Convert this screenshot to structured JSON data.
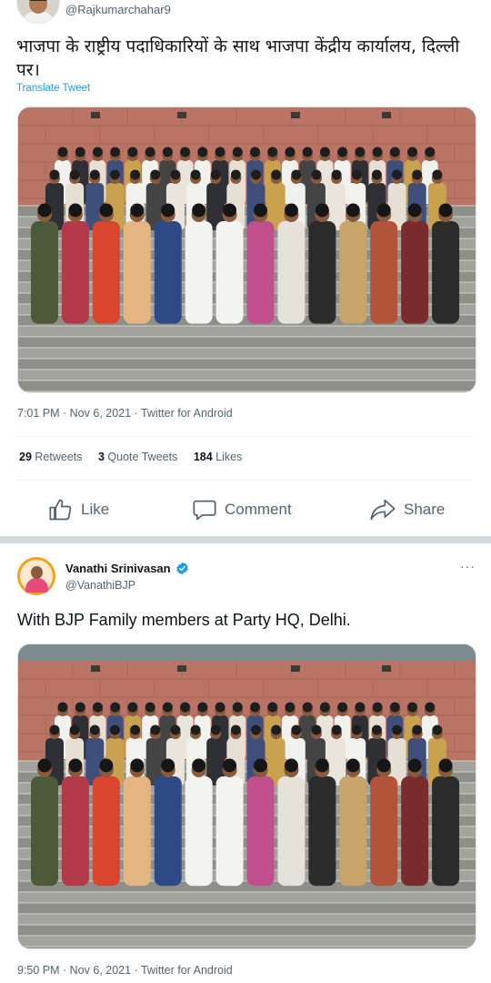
{
  "tweet1": {
    "handle": "@Rajkumarchahar9",
    "text": "भाजपा के राष्ट्रीय पदाधिकारियों के साथ भाजपा केंद्रीय कार्यालय, दिल्ली पर।",
    "translate": "Translate Tweet",
    "timestamp": "7:01 PM · Nov 6, 2021 · Twitter for Android",
    "stats": {
      "retweets_count": "29",
      "retweets_label": "Retweets",
      "quotes_count": "3",
      "quotes_label": "Quote Tweets",
      "likes_count": "184",
      "likes_label": "Likes"
    },
    "actions": {
      "like": "Like",
      "comment": "Comment",
      "share": "Share"
    },
    "photo_alt_icon": "group-photo"
  },
  "tweet2": {
    "name": "Vanathi Srinivasan",
    "verified_icon": "verified-badge-icon",
    "handle": "@VanathiBJP",
    "more": "···",
    "text": "With BJP Family members at Party HQ, Delhi.",
    "timestamp": "9:50 PM · Nov 6, 2021 · Twitter for Android"
  },
  "colors": {
    "link": "#1d9bf0",
    "muted": "#536471",
    "text": "#0f1419",
    "building": "#b97466",
    "steps": "#9a9a96"
  }
}
